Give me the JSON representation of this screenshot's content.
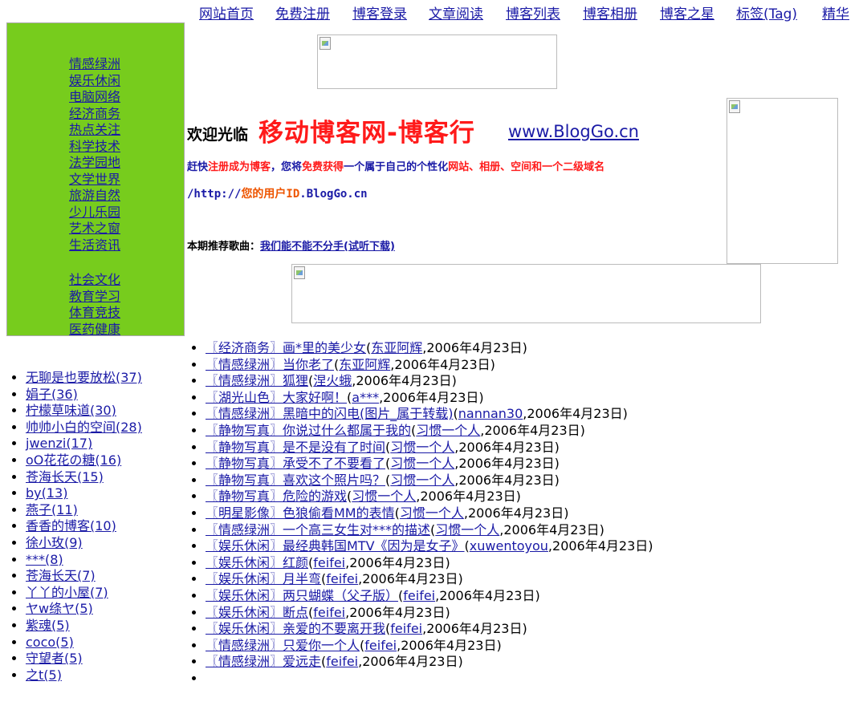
{
  "nav": [
    "网站首页",
    "免费注册",
    "博客登录",
    "文章阅读",
    "博客列表",
    "博客相册",
    "博客之星",
    "标签(Tag)",
    "精华"
  ],
  "sidebar": {
    "categories_1": [
      "情感绿洲",
      "娱乐休闲",
      "电脑网络",
      "经济商务",
      "热点关注",
      "科学技术",
      "法学园地",
      "文学世界",
      "旅游自然",
      "少儿乐园",
      "艺术之窗",
      "生活资讯"
    ],
    "categories_2": [
      "社会文化",
      "教育学习",
      "体育竞技",
      "医药健康"
    ]
  },
  "welcome": {
    "greeting": "欢迎光临",
    "site_name": "移动博客网-博客行",
    "url": "www.BlogGo.cn"
  },
  "promo": {
    "p1": "赶快",
    "p2": "注册成为博客",
    "p3": "，您将",
    "p4": "免费获得",
    "p5": "一个属于自己的个性化",
    "p6": "网站、相册、空间和一个二级域名"
  },
  "domain": {
    "prefix": "/http://",
    "user": "您的用户ID",
    "host": ".BlogGo.cn"
  },
  "song": {
    "label": "本期推荐歌曲：",
    "link": "我们能不能不分手(试听下载)"
  },
  "blogs": [
    "无聊是也要放松(37)",
    "娟子(36)",
    "柠檬草味道(30)",
    "帅帅小白的空间(28)",
    "jwenzi(17)",
    "oO花花の糖(16)",
    "苍海长天(15)",
    "by(13)",
    "燕子(11)",
    "香香的博客(10)",
    "徐小玫(9)",
    "***(8)",
    "苍海长天(7)",
    "丫丫的小屋(7)",
    "ヤw绦ヤ(5)",
    "紫魂(5)",
    "coco(5)",
    "守望者(5)",
    "之t(5)"
  ],
  "articles": [
    {
      "title": "〖经济商务〗画*里的美少女",
      "author": "东亚阿辉",
      "date": ",2006年4月23日)"
    },
    {
      "title": "〖情感绿洲〗当你老了",
      "author": "东亚阿辉",
      "date": ",2006年4月23日)"
    },
    {
      "title": "〖情感绿洲〗狐狸",
      "author": "涅火蛾",
      "date": ",2006年4月23日)"
    },
    {
      "title": "〖湖光山色〗大家好啊！",
      "author": "a***",
      "date": ",2006年4月23日)"
    },
    {
      "title": "〖情感绿洲〗黑暗中的闪电(图片_属于转载)",
      "author": "nannan30",
      "date": ",2006年4月23日)"
    },
    {
      "title": "〖静物写真〗你说过什么都属于我的",
      "author": "习惯一个人",
      "date": ",2006年4月23日)"
    },
    {
      "title": "〖静物写真〗是不是没有了时间",
      "author": "习惯一个人",
      "date": ",2006年4月23日)"
    },
    {
      "title": "〖静物写真〗承受不了不要看了",
      "author": "习惯一个人",
      "date": ",2006年4月23日)"
    },
    {
      "title": "〖静物写真〗喜欢这个照片吗？",
      "author": "习惯一个人",
      "date": ",2006年4月23日)"
    },
    {
      "title": "〖静物写真〗危险的游戏",
      "author": "习惯一个人",
      "date": ",2006年4月23日)"
    },
    {
      "title": "〖明星影像〗色狼偷看MM的表情",
      "author": "习惯一个人",
      "date": ",2006年4月23日)"
    },
    {
      "title": "〖情感绿洲〗一个高三女生对***的描述",
      "author": "习惯一个人",
      "date": ",2006年4月23日)"
    },
    {
      "title": "〖娱乐休闲〗最经典韩国MTV《因为是女子》",
      "author": "xuwentoyou",
      "date": ",2006年4月23日)"
    },
    {
      "title": "〖娱乐休闲〗红颜",
      "author": "feifei",
      "date": ",2006年4月23日)"
    },
    {
      "title": "〖娱乐休闲〗月半弯",
      "author": "feifei",
      "date": ",2006年4月23日)"
    },
    {
      "title": "〖娱乐休闲〗两只蝴蝶（父子版）",
      "author": "feifei",
      "date": ",2006年4月23日)"
    },
    {
      "title": "〖娱乐休闲〗断点",
      "author": "feifei",
      "date": ",2006年4月23日)"
    },
    {
      "title": "〖娱乐休闲〗亲爱的不要离开我",
      "author": "feifei",
      "date": ",2006年4月23日)"
    },
    {
      "title": "〖情感绿洲〗只爱你一个人",
      "author": "feifei",
      "date": ",2006年4月23日)"
    },
    {
      "title": "〖情感绿洲〗爱远走",
      "author": "feifei",
      "date": ",2006年4月23日)"
    }
  ]
}
